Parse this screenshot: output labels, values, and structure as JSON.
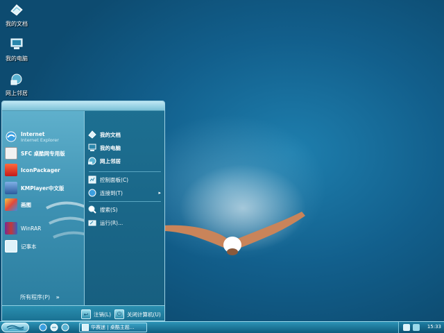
{
  "desktop": {
    "icons": [
      {
        "label": "我的文档",
        "icon": "my-documents-icon"
      },
      {
        "label": "我的电脑",
        "icon": "my-computer-icon"
      },
      {
        "label": "网上邻居",
        "icon": "network-places-icon"
      }
    ]
  },
  "start_menu": {
    "pinned": {
      "title": "Internet",
      "subtitle": "Internet Explorer",
      "icon": "internet-explorer-icon"
    },
    "programs": [
      {
        "label": "SFC 桌酷网专用版",
        "icon": "sfc-icon"
      },
      {
        "label": "IconPackager",
        "icon": "iconpackager-icon"
      },
      {
        "label": "KMPlayer中文版",
        "icon": "kmplayer-icon"
      },
      {
        "label": "画图",
        "icon": "paint-icon"
      },
      {
        "label": "WinRAR",
        "icon": "winrar-icon"
      },
      {
        "label": "记事本",
        "icon": "notepad-icon"
      }
    ],
    "all_programs": {
      "label": "所有程序(P)",
      "arrow": "»"
    },
    "places": [
      {
        "label": "我的文档",
        "icon": "my-documents-icon"
      },
      {
        "label": "我的电脑",
        "icon": "my-computer-icon"
      },
      {
        "label": "网上邻居",
        "icon": "network-places-icon"
      }
    ],
    "system": [
      {
        "label": "控制面板(C)",
        "icon": "control-panel-icon"
      },
      {
        "label": "连接到(T)",
        "icon": "connect-to-icon",
        "arrow": "▸"
      },
      {
        "label": "搜索(S)",
        "icon": "search-icon"
      },
      {
        "label": "运行(R)...",
        "icon": "run-icon"
      }
    ],
    "logoff": {
      "label": "注销(L)",
      "icon": "logoff-icon"
    },
    "shutdown": {
      "label": "关闭计算机(U)",
      "icon": "power-icon"
    }
  },
  "taskbar": {
    "task_label": "华赛迷 | 桌酷主题...",
    "clock": "15:33",
    "colors": {
      "accent": "#1e7fae",
      "dark": "#0f5d7e"
    }
  }
}
